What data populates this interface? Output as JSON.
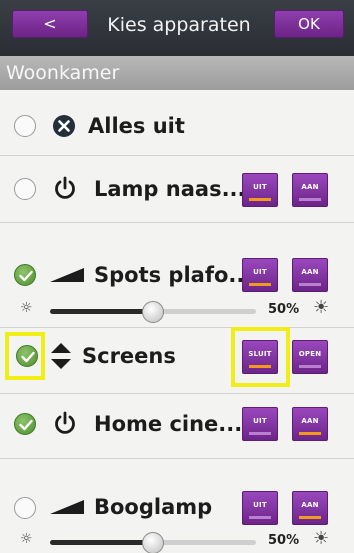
{
  "header": {
    "back_label": "<",
    "title": "Kies apparaten",
    "ok_label": "OK"
  },
  "section": {
    "title": "Woonkamer"
  },
  "devices": [
    {
      "label": "Alles uit",
      "selected": false,
      "icon": "close-circle-icon"
    },
    {
      "label": "Lamp naas...",
      "selected": false,
      "icon": "power-icon",
      "buttons": [
        "UIT",
        "AAN"
      ],
      "active": "UIT"
    },
    {
      "label": "Spots plafo...",
      "selected": true,
      "icon": "dimmer-wedge-icon",
      "buttons": [
        "UIT",
        "AAN"
      ],
      "active": "UIT",
      "level": 0.5,
      "level_text": "50%"
    },
    {
      "label": "Screens",
      "selected": true,
      "icon": "up-down-arrows-icon",
      "buttons": [
        "SLUIT",
        "OPEN"
      ],
      "active": "SLUIT"
    },
    {
      "label": "Home cine...",
      "selected": true,
      "icon": "power-icon",
      "buttons": [
        "UIT",
        "AAN"
      ],
      "active": "AAN"
    },
    {
      "label": "Booglamp",
      "selected": false,
      "icon": "dimmer-wedge-icon",
      "buttons": [
        "UIT",
        "AAN"
      ],
      "active": "AAN",
      "level": 0.5,
      "level_text": "50%"
    }
  ],
  "colors": {
    "accent_purple": "#7b2d9a",
    "active_indicator": "#f09a1e",
    "highlight": "#f1ee16",
    "check_green": "#5a9c38"
  }
}
